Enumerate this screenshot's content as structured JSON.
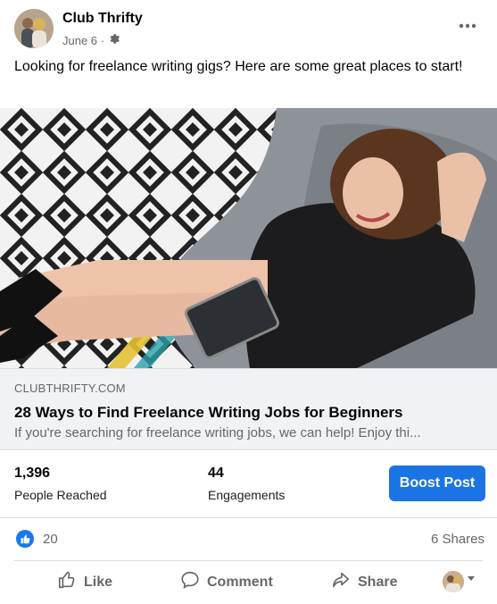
{
  "post": {
    "page_name": "Club Thrifty",
    "date": "June 6",
    "separator": "·",
    "text": "Looking for freelance writing gigs? Here are some great places to start!"
  },
  "link": {
    "domain": "CLUBTHRIFTY.COM",
    "title": "28 Ways to Find Freelance Writing Jobs for Beginners",
    "description": "If you're searching for freelance writing jobs, we can help! Enjoy thi..."
  },
  "stats": {
    "reached_value": "1,396",
    "reached_label": "People Reached",
    "engagements_value": "44",
    "engagements_label": "Engagements",
    "boost_label": "Boost Post"
  },
  "reactions": {
    "count": "20",
    "shares": "6 Shares"
  },
  "actions": {
    "like": "Like",
    "comment": "Comment",
    "share": "Share"
  },
  "icons": {
    "more": "more-horizontal-icon",
    "privacy": "gear-icon",
    "like": "thumbs-up-icon",
    "comment": "speech-bubble-icon",
    "share": "share-arrow-icon"
  },
  "colors": {
    "accent": "#1b74e4",
    "like_badge": "#1877f2",
    "secondary_text": "#65676b"
  }
}
